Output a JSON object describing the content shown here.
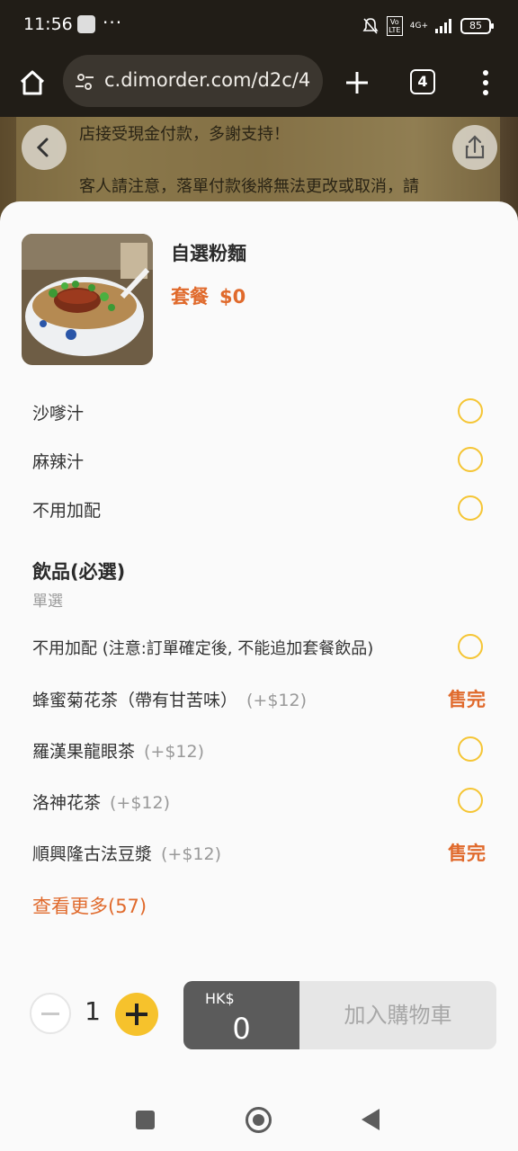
{
  "status_bar": {
    "time": "11:56",
    "dots": "···",
    "network_label": "4G+",
    "volte": "Vo LTE",
    "battery": "85"
  },
  "browser": {
    "url": "c.dimorder.com/d2c/4",
    "tab_count": "4"
  },
  "background_page": {
    "line1": "店接受現金付款，多謝支持！",
    "line2": "客人請注意，落單付款後將無法更改或取消，請"
  },
  "item": {
    "title": "自選粉麵",
    "set_label": "套餐",
    "set_price": "$0"
  },
  "sauce_options": [
    {
      "label": "沙嗲汁"
    },
    {
      "label": "麻辣汁"
    },
    {
      "label": "不用加配"
    }
  ],
  "drinks_section": {
    "title": "飲品(必選)",
    "subtitle": "單選",
    "options": [
      {
        "label": "不用加配 (注意:訂單確定後, 不能追加套餐飲品)",
        "price": "",
        "status": "radio"
      },
      {
        "label": "蜂蜜菊花茶（帶有甘苦味）",
        "price": "(+$12)",
        "status": "售完"
      },
      {
        "label": "羅漢果龍眼茶",
        "price": "(+$12)",
        "status": "radio"
      },
      {
        "label": "洛神花茶",
        "price": "(+$12)",
        "status": "radio"
      },
      {
        "label": "順興隆古法豆漿",
        "price": "(+$12)",
        "status": "售完"
      }
    ],
    "more_link": "查看更多(57)"
  },
  "cart": {
    "quantity": "1",
    "currency": "HK$",
    "total": "0",
    "add_label": "加入購物車"
  },
  "colors": {
    "accent": "#e06a2c",
    "radio": "#f5c534",
    "plus_button": "#f6c22c",
    "total_bg": "#5b5b5b"
  },
  "icons": {
    "home": "home-icon",
    "site_settings": "tune-icon",
    "new_tab": "plus-icon",
    "more": "more-vert-icon",
    "back": "chevron-left-icon",
    "share": "share-icon"
  }
}
